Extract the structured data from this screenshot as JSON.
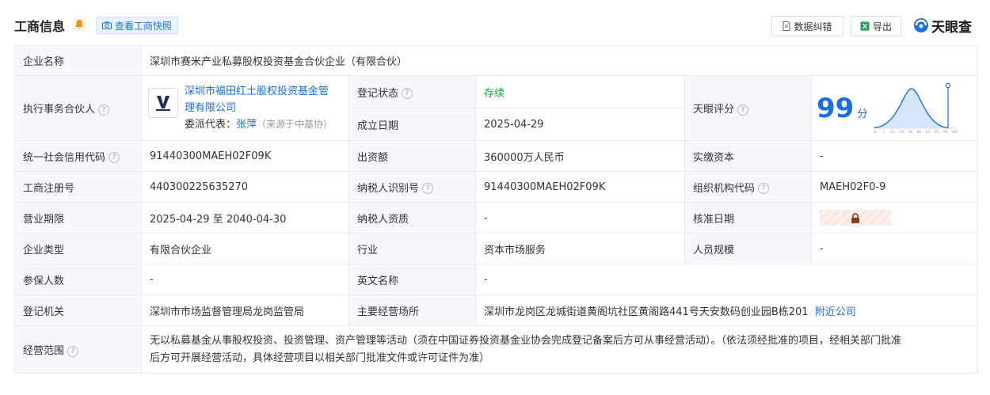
{
  "header": {
    "title": "工商信息",
    "snapshot_label": "查看工商快照",
    "correct_label": "数据纠错",
    "export_label": "导出",
    "brand": "天眼查"
  },
  "company_name": {
    "label": "企业名称",
    "value": "深圳市赛米产业私募股权投资基金合伙企业（有限合伙）"
  },
  "partner": {
    "label": "执行事务合伙人",
    "name_line1": "深圳市福田红土股权投资基金管",
    "name_line2": "理有限公司",
    "rep_label": "委派代表：",
    "rep_name": "张萍",
    "rep_source": "（来源于中基协）"
  },
  "reg_status": {
    "label": "登记状态",
    "value": "存续"
  },
  "found_date": {
    "label": "成立日期",
    "value": "2025-04-29"
  },
  "score": {
    "label": "天眼评分",
    "value": "99",
    "unit": "分",
    "axis": [
      "0",
      "1",
      "15",
      "25",
      "50",
      "80",
      "67",
      "85",
      "95",
      "100"
    ]
  },
  "rows": [
    {
      "l1": "统一社会信用代码",
      "v1": "91440300MAEH02F09K",
      "l2": "出资额",
      "v2": "360000万人民币",
      "l3": "实缴资本",
      "v3": "-"
    },
    {
      "l1": "工商注册号",
      "v1": "440300225635270",
      "l2": "纳税人识别号",
      "v2": "91440300MAEH02F09K",
      "l3": "组织机构代码",
      "v3": "MAEH02F0-9"
    },
    {
      "l1": "营业期限",
      "v1": "2025-04-29 至 2040-04-30",
      "l2": "纳税人资质",
      "v2": "-",
      "l3": "核准日期",
      "v3": ""
    },
    {
      "l1": "企业类型",
      "v1": "有限合伙企业",
      "l2": "行业",
      "v2": "资本市场服务",
      "l3": "人员规模",
      "v3": "-"
    },
    {
      "l1": "参保人数",
      "v1": "-",
      "l2": "英文名称",
      "v2": "-"
    },
    {
      "l1": "登记机关",
      "v1": "深圳市市场监督管理局龙岗监管局",
      "l2": "主要经营场所",
      "v2": "深圳市龙岗区龙城街道黄阁坑社区黄阁路441号天安数码创业园B栋201",
      "link": "附近公司"
    }
  ],
  "scope": {
    "label": "经营范围",
    "line1": "无以私募基金从事股权投资、投资管理、资产管理等活动（须在中国证券投资基金业协会完成登记备案后方可从事经营活动）。（依法须经批准的项目，经相关部门批准",
    "line2": "后方可开展经营活动，具体经营项目以相关部门批准文件或许可证件为准）"
  },
  "colors": {
    "accent": "#1a6fe0",
    "label_bg": "#f5f8fc",
    "status": "#15a34a"
  }
}
